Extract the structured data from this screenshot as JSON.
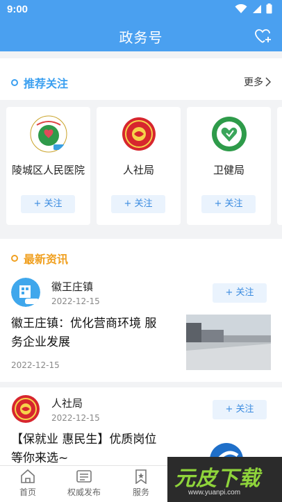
{
  "status_bar": {
    "time": "9:00"
  },
  "header": {
    "title": "政务号"
  },
  "recommend": {
    "title": "推荐关注",
    "more_label": "更多",
    "cards": [
      {
        "name": "陵城区人民医院",
        "follow_label": "+ 关注"
      },
      {
        "name": "人社局",
        "follow_label": "+ 关注"
      },
      {
        "name": "卫健局",
        "follow_label": "+ 关注"
      }
    ]
  },
  "news": {
    "title": "最新资讯",
    "items": [
      {
        "source": "徽王庄镇",
        "source_date": "2022-12-15",
        "follow_label": "+ 关注",
        "headline_line1": "徽王庄镇：优化营商环境 服",
        "headline_line2": "务企业发展",
        "date": "2022-12-15"
      },
      {
        "source": "人社局",
        "source_date": "2022-12-15",
        "follow_label": "+ 关注",
        "headline_line1": "【保就业 惠民生】优质岗位",
        "headline_line2": "等你来选~"
      }
    ]
  },
  "tabbar": {
    "tabs": [
      {
        "label": "首页"
      },
      {
        "label": "权威发布"
      },
      {
        "label": "服务"
      }
    ]
  },
  "watermark": {
    "main": "元皮下载",
    "url": "www.yuanpi.com"
  },
  "colors": {
    "header_bg": "#4aa0f0",
    "accent_blue": "#3a8be0",
    "accent_gold": "#f0a020"
  }
}
